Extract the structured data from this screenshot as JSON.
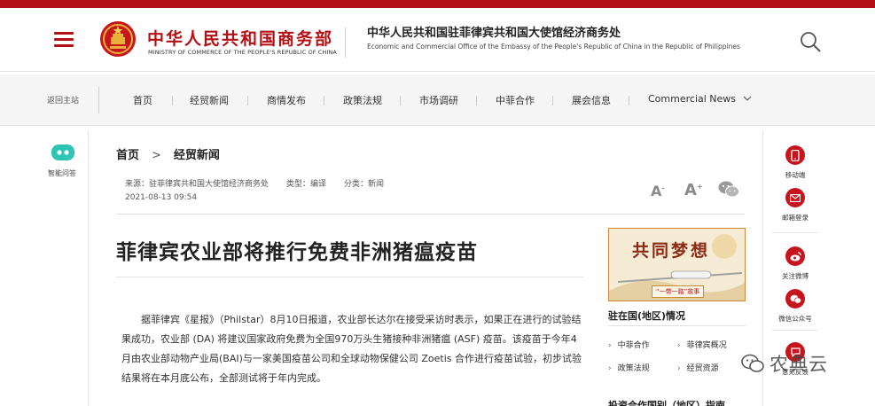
{
  "header": {
    "ministry_cn": "中华人民共和国商务部",
    "ministry_en": "MINISTRY OF COMMERCE OF THE PEOPLE'S REPUBLIC OF CHINA",
    "office_cn": "中华人民共和国驻菲律宾共和国大使馆经济商务处",
    "office_en": "Economic and Commercial Office of the Embassy of the People's Republic of China in the Republic of Philippines"
  },
  "nav": {
    "back": "返回主站",
    "items": [
      "首页",
      "经贸新闻",
      "商情发布",
      "政策法规",
      "市场调研",
      "中菲合作",
      "展会信息",
      "Commercial News"
    ]
  },
  "left_panel": {
    "chatbot_label": "智能问答"
  },
  "breadcrumb": {
    "home": "首页",
    "sep": ">",
    "current": "经贸新闻"
  },
  "meta": {
    "source": "来源：驻菲律宾共和国大使馆经济商务处",
    "type": "类型：编译",
    "category": "分类：新闻",
    "date": "2021-08-13 09:54"
  },
  "font_controls": {
    "small": "A",
    "large": "A"
  },
  "article": {
    "title": "菲律宾农业部将推行免费非洲猪瘟疫苗",
    "body": "据菲律宾《星报》（Philstar）8月10日报道，农业部长达尔在接受采访时表示，如果正在进行的试验结果成功，农业部 (DA) 将建议国家政府免费为全国970万头生猪接种非洲猪瘟 (ASF) 疫苗。该疫苗于今年4月由农业部动物产业局(BAI)与一家美国疫苗公司和全球动物保健公司 Zoetis 合作进行疫苗试验，初步试验结果将在本月底公布，全部测试将于年内完成。"
  },
  "banner": {
    "title": "共同梦想",
    "subtitle": "“一带一路”故事"
  },
  "sidebar": {
    "heading": "驻在国(地区)情况",
    "links": [
      "中菲合作",
      "菲律宾概况",
      "政策法规",
      "经贸资源"
    ],
    "heading2": "投资合作国别（地区）指南"
  },
  "tools": {
    "mobile": "移动端",
    "email": "邮箱登录",
    "weibo": "关注微博",
    "wechat": "微信公众号",
    "feedback": "意见反馈"
  },
  "watermark": {
    "text": "农典云"
  },
  "colors": {
    "brand_red": "#b31016",
    "tool_red": "#c7151d"
  }
}
